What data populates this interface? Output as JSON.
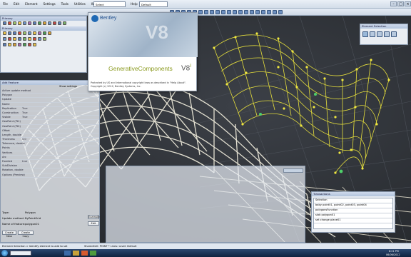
{
  "window": {
    "title": "GenerativeComponents V8i"
  },
  "menu": [
    "File",
    "Edit",
    "Element",
    "Settings",
    "Tools",
    "Utilities",
    "Workspace",
    "Window",
    "Help"
  ],
  "toolbar": {
    "select_label": "Select",
    "select_value": "Default"
  },
  "tool_palette": {
    "title": "Primary",
    "sub_title": "Primary"
  },
  "transaction_panel": {
    "title": "Add Feature",
    "show_settings": "Show settings",
    "rows": [
      {
        "k": "Active update method",
        "v": ""
      },
      {
        "k": "Polygon",
        "v": ""
      },
      {
        "k": "Update",
        "v": ""
      },
      {
        "k": "Name",
        "v": ""
      },
      {
        "k": "Replication",
        "v": "True"
      },
      {
        "k": "Construction",
        "v": "True"
      },
      {
        "k": "Visible",
        "v": "True"
      },
      {
        "k": "GeoPoint (Pt1)",
        "v": ""
      },
      {
        "k": "GeoPoint (Pt2)",
        "v": ""
      },
      {
        "k": "Offset",
        "v": ""
      },
      {
        "k": "Length, double",
        "v": ""
      },
      {
        "k": "Thickness",
        "v": "0.0"
      },
      {
        "k": "Tolerance, double",
        "v": ""
      },
      {
        "k": "Points",
        "v": ""
      },
      {
        "k": "Vertices",
        "v": ""
      },
      {
        "k": "Arc",
        "v": ""
      },
      {
        "k": "Faceted",
        "v": "true"
      },
      {
        "k": "SubDivision",
        "v": ""
      },
      {
        "k": "Rotation, double",
        "v": ""
      },
      {
        "k": "Options (Preview)",
        "v": ""
      }
    ],
    "type_label": "Type:",
    "type_value": "Polygon",
    "update_label": "Update method:",
    "update_value": "ByPointGrid",
    "name_label": "Name of feature:",
    "name_value": "polygon01",
    "example_btn": "Example",
    "edit_btn": "Edit",
    "create_new": "Create New",
    "create_copy": "Create Copy"
  },
  "splash": {
    "brand": "Bentley",
    "logo_v": "V8",
    "product": "GenerativeComponents",
    "product_v": "V8",
    "product_i": "i",
    "line1": "Protected by US and international copyright laws as described in \"Help About\".",
    "line2": "Copyright (c) 2012, Bentley Systems, Inc."
  },
  "element_selection": {
    "title": "Element Selection"
  },
  "transactions": {
    "title": "Transactions",
    "items": [
      "Selection",
      "baby point01, point02, point03, point04",
      "polygonsFunction",
      "slab polygon01",
      "set change plane01"
    ]
  },
  "status": {
    "left": "Element Selection > Identify element to add to set",
    "middle": "SharedCell: POINT * Lines: Level: Default"
  },
  "taskbar": {
    "time": "8:21 PM",
    "date": "06/06/2012"
  },
  "colors": {
    "viewport_bg": "#2e3136",
    "grid_shell": "#d8d6c8",
    "wire_yellow": "#e9e23a"
  }
}
